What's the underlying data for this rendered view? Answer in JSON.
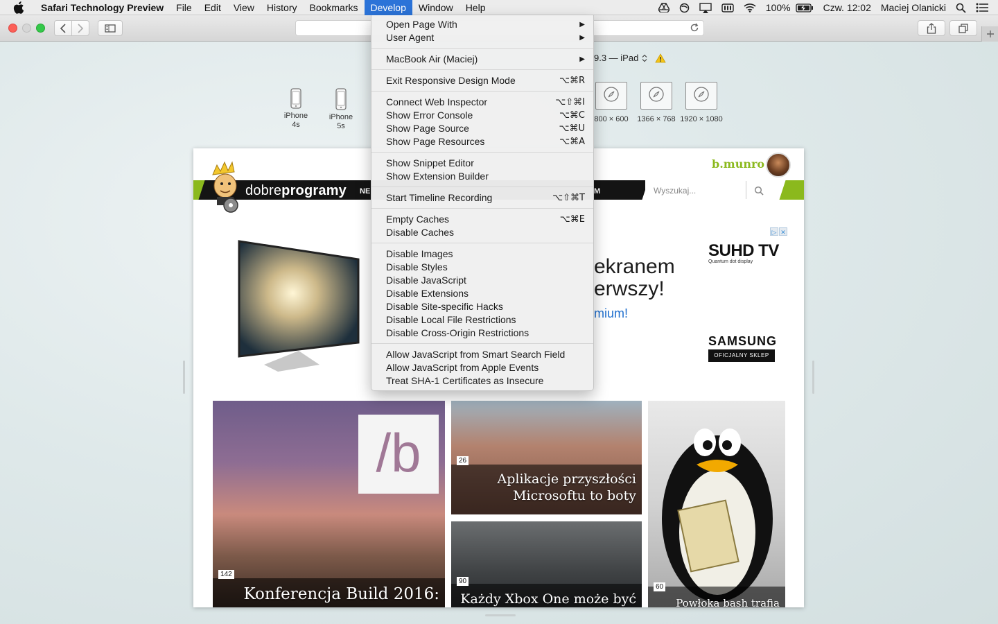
{
  "menubar": {
    "app_name": "Safari Technology Preview",
    "items": [
      "File",
      "Edit",
      "View",
      "History",
      "Bookmarks",
      "Develop",
      "Window",
      "Help"
    ],
    "active": "Develop",
    "battery": "100%",
    "clock": "Czw. 12:02",
    "user": "Maciej Olanicki"
  },
  "responsive": {
    "device_line": "9.3 — iPad",
    "devices": [
      {
        "label_1": "iPhone",
        "label_2": "4s"
      },
      {
        "label_1": "iPhone",
        "label_2": "5s"
      }
    ],
    "screens": [
      "800 × 600",
      "1366 × 768",
      "1920 × 1080"
    ]
  },
  "develop_menu": {
    "groups": [
      [
        {
          "label": "Open Page With",
          "submenu": true
        },
        {
          "label": "User Agent",
          "submenu": true
        }
      ],
      [
        {
          "label": "MacBook Air (Maciej)",
          "submenu": true
        }
      ],
      [
        {
          "label": "Exit Responsive Design Mode",
          "shortcut": "⌥⌘R"
        }
      ],
      [
        {
          "label": "Connect Web Inspector",
          "shortcut": "⌥⇧⌘I"
        },
        {
          "label": "Show Error Console",
          "shortcut": "⌥⌘C"
        },
        {
          "label": "Show Page Source",
          "shortcut": "⌥⌘U"
        },
        {
          "label": "Show Page Resources",
          "shortcut": "⌥⌘A"
        }
      ],
      [
        {
          "label": "Show Snippet Editor"
        },
        {
          "label": "Show Extension Builder"
        }
      ],
      [
        {
          "label": "Start Timeline Recording",
          "shortcut": "⌥⇧⌘T"
        }
      ],
      [
        {
          "label": "Empty Caches",
          "shortcut": "⌥⌘E"
        },
        {
          "label": "Disable Caches"
        }
      ],
      [
        {
          "label": "Disable Images"
        },
        {
          "label": "Disable Styles"
        },
        {
          "label": "Disable JavaScript"
        },
        {
          "label": "Disable Extensions"
        },
        {
          "label": "Disable Site-specific Hacks"
        },
        {
          "label": "Disable Local File Restrictions"
        },
        {
          "label": "Disable Cross-Origin Restrictions"
        }
      ],
      [
        {
          "label": "Allow JavaScript from Smart Search Field"
        },
        {
          "label": "Allow JavaScript from Apple Events"
        },
        {
          "label": "Treat SHA-1 Certificates as Insecure"
        }
      ]
    ]
  },
  "site": {
    "logo_light": "dobre",
    "logo_bold": "programy",
    "nav_partial": "NE",
    "nav_partial_right": "M",
    "search_placeholder": "Wyszukaj...",
    "username": "b.munro",
    "ad": {
      "line1": "ekranem",
      "line2": "erwszy!",
      "line3": "mium!",
      "brand": "SUHD TV",
      "brand_sub": "Quantum dot display",
      "samsung": "SAMSUNG",
      "samsung_badge": "OFICJALNY SKLEP",
      "close_1": "▷",
      "close_2": "✕"
    },
    "tiles": [
      {
        "title": "Konferencja Build 2016:",
        "count": "142",
        "logo": "/b"
      },
      {
        "title_1": "Aplikacje przyszłości",
        "title_2": "Microsoftu to boty",
        "count": "26"
      },
      {
        "title": "Każdy Xbox One może być",
        "count": "90"
      },
      {
        "title": "Powłoka bash trafia",
        "count": "60"
      }
    ]
  }
}
